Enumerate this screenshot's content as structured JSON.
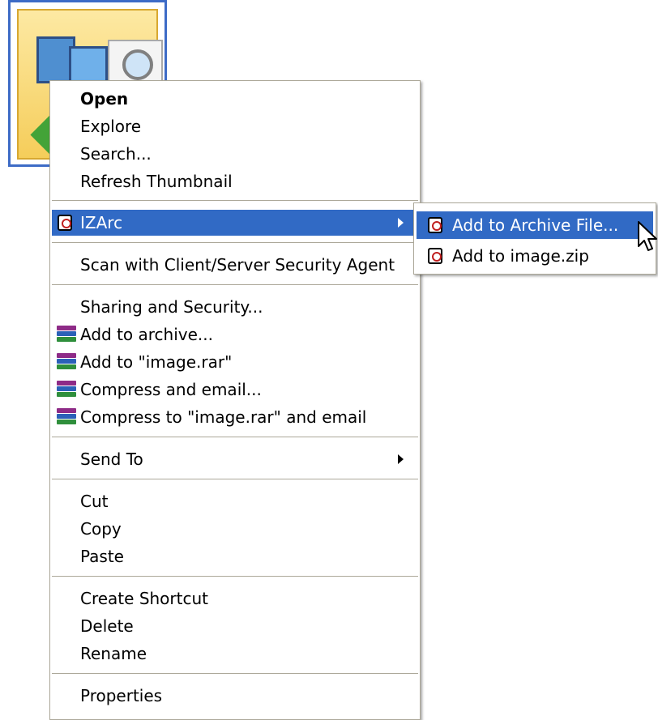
{
  "context_menu": {
    "items": [
      {
        "label": "Open",
        "bold": true
      },
      {
        "label": "Explore"
      },
      {
        "label": "Search..."
      },
      {
        "label": "Refresh Thumbnail"
      },
      {
        "label": "IZArc",
        "selected": true,
        "icon": "izarc-icon",
        "submenu": true
      },
      {
        "label": "Scan with Client/Server Security Agent"
      },
      {
        "label": "Sharing and Security..."
      },
      {
        "label": "Add to archive...",
        "icon": "winrar-icon"
      },
      {
        "label": "Add to \"image.rar\"",
        "icon": "winrar-icon"
      },
      {
        "label": "Compress and email...",
        "icon": "winrar-icon"
      },
      {
        "label": "Compress to \"image.rar\" and email",
        "icon": "winrar-icon"
      },
      {
        "label": "Send To",
        "submenu": true
      },
      {
        "label": "Cut"
      },
      {
        "label": "Copy"
      },
      {
        "label": "Paste"
      },
      {
        "label": "Create Shortcut"
      },
      {
        "label": "Delete"
      },
      {
        "label": "Rename"
      },
      {
        "label": "Properties"
      }
    ]
  },
  "izarc_submenu": {
    "items": [
      {
        "label": "Add to Archive File...",
        "selected": true,
        "icon": "izarc-icon"
      },
      {
        "label": "Add to image.zip",
        "icon": "izarc-icon"
      }
    ]
  },
  "colors": {
    "highlight": "#316ac5",
    "menu_border": "#aca899",
    "thumbnail_border": "#3d6bc6"
  }
}
